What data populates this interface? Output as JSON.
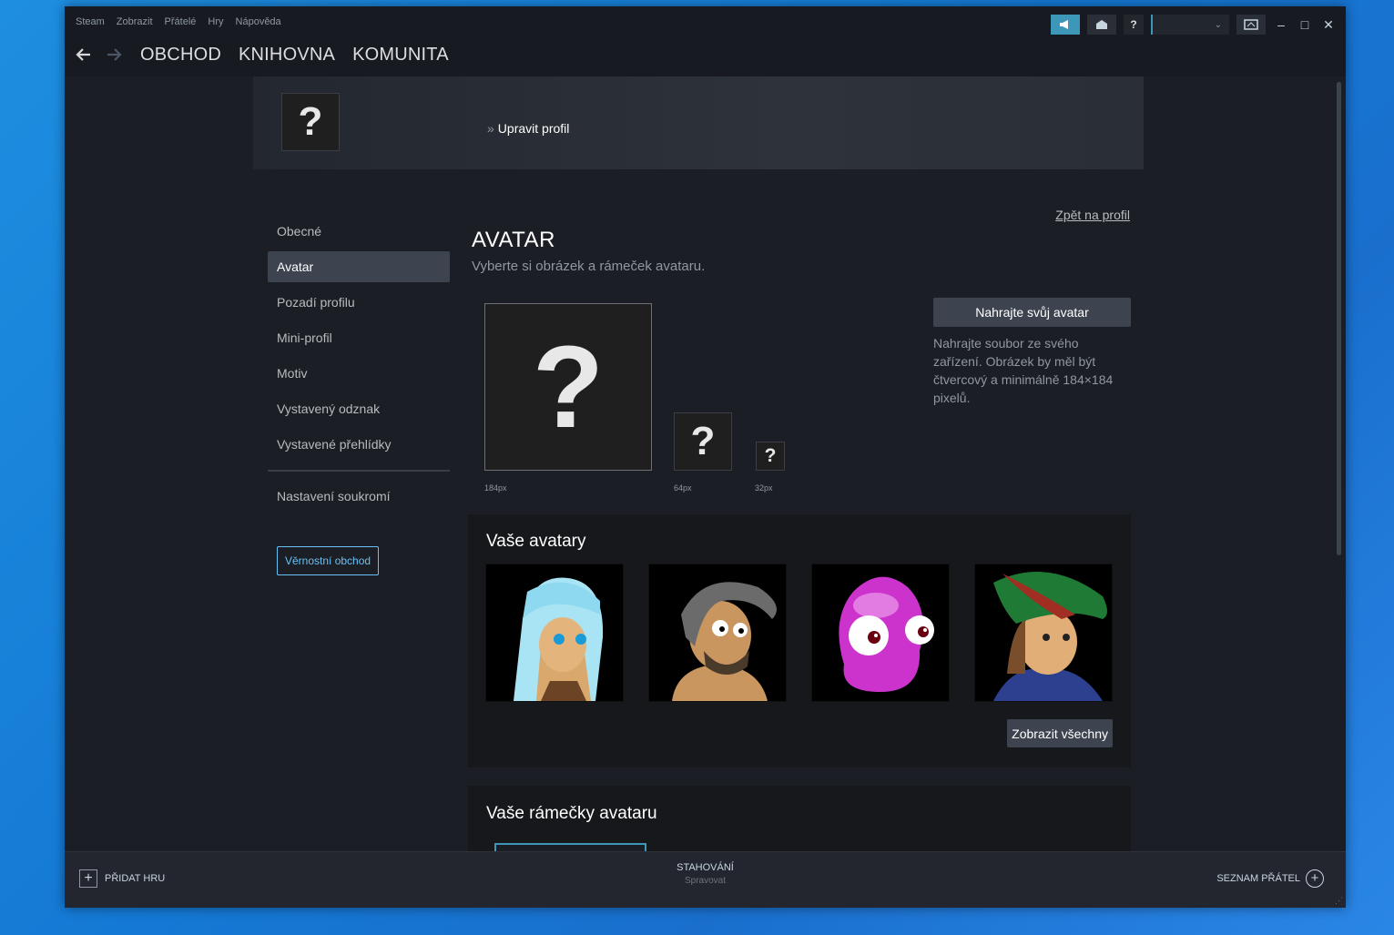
{
  "menu": [
    "Steam",
    "Zobrazit",
    "Přátelé",
    "Hry",
    "Nápověda"
  ],
  "nav": {
    "tabs": [
      "OBCHOD",
      "KNIHOVNA",
      "KOMUNITA"
    ]
  },
  "titlebar": {
    "help": "?"
  },
  "header": {
    "avatar_placeholder": "?",
    "breadcrumb_sep": "»",
    "breadcrumb": "Upravit profil"
  },
  "back_link": "Zpět na profil",
  "sidebar": {
    "items": [
      "Obecné",
      "Avatar",
      "Pozadí profilu",
      "Mini-profil",
      "Motiv",
      "Vystavený odznak",
      "Vystavené přehlídky"
    ],
    "privacy": "Nastavení soukromí",
    "loyalty": "Věrnostní obchod"
  },
  "avatar": {
    "title": "AVATAR",
    "subtitle": "Vyberte si obrázek a rámeček avataru.",
    "preview_glyph": "?",
    "sizes": [
      "184px",
      "64px",
      "32px"
    ],
    "upload_button": "Nahrajte svůj avatar",
    "upload_desc": "Nahrajte soubor ze svého zařízení. Obrázek by měl být čtvercový a minimálně 184×184 pixelů."
  },
  "your_avatars": {
    "title": "Vaše avatary",
    "show_all": "Zobrazit všechny"
  },
  "your_frames": {
    "title": "Vaše rámečky avataru"
  },
  "bottom": {
    "add_game": "PŘIDAT HRU",
    "downloads": "STAHOVÁNÍ",
    "manage": "Spravovat",
    "friends": "SEZNAM PŘÁTEL"
  },
  "colors": {
    "accent": "#3d97b8",
    "link_blue": "#67c1f5",
    "panel": "#16181c",
    "background": "#1b1e24"
  }
}
